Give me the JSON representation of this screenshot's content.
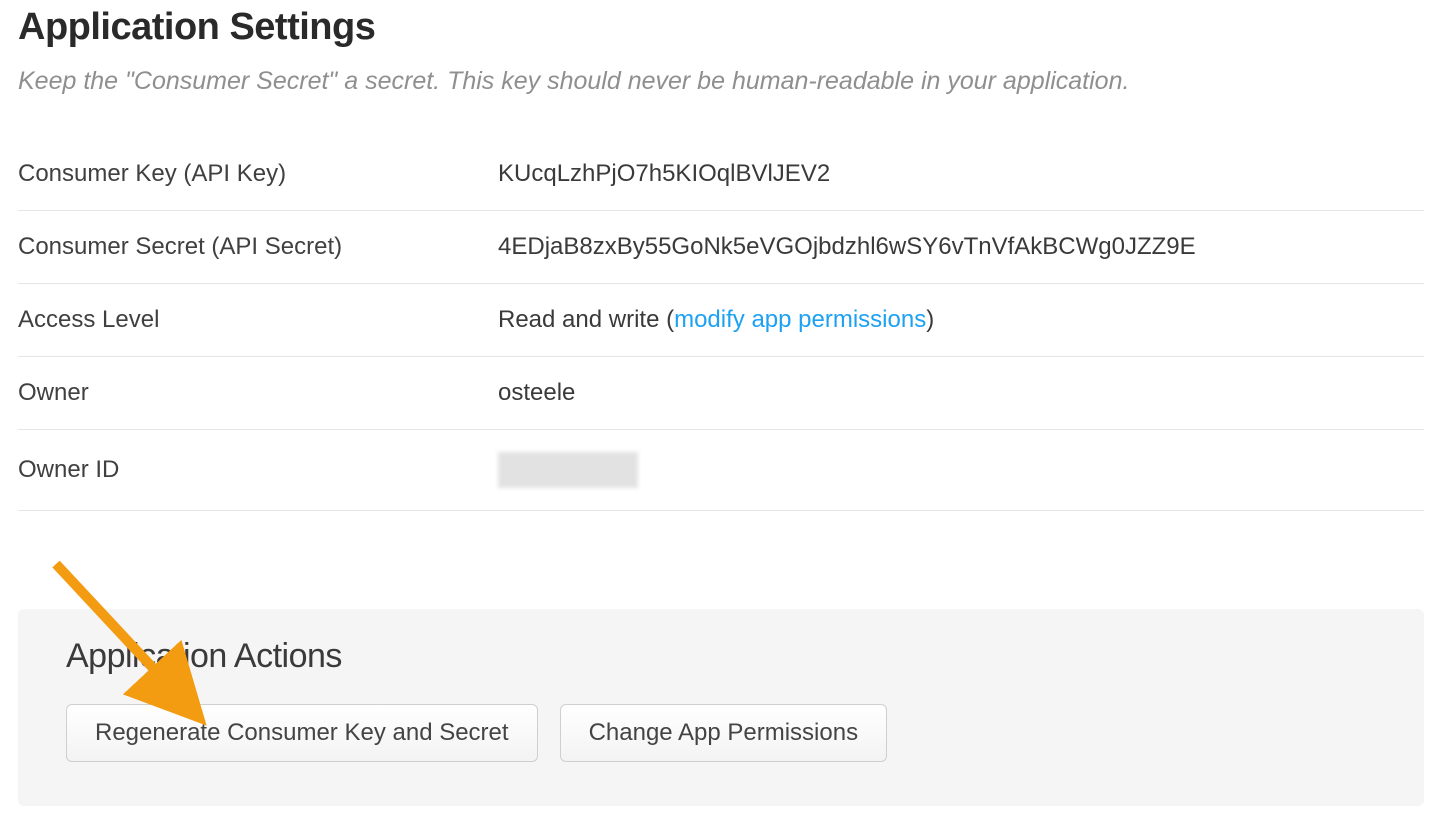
{
  "header": {
    "title": "Application Settings",
    "subtitle": "Keep the \"Consumer Secret\" a secret. This key should never be human-readable in your application."
  },
  "settings": {
    "rows": [
      {
        "label": "Consumer Key (API Key)",
        "value": "KUcqLzhPjO7h5KIOqlBVlJEV2"
      },
      {
        "label": "Consumer Secret (API Secret)",
        "value": "4EDjaB8zxBy55GoNk5eVGOjbdzhl6wSY6vTnVfAkBCWg0JZZ9E"
      },
      {
        "label": "Access Level",
        "value": "Read and write (",
        "link_text": "modify app permissions",
        "suffix": ")"
      },
      {
        "label": "Owner",
        "value": "osteele"
      },
      {
        "label": "Owner ID",
        "value": ""
      }
    ]
  },
  "actions": {
    "title": "Application Actions",
    "buttons": {
      "regenerate": "Regenerate Consumer Key and Secret",
      "change_permissions": "Change App Permissions"
    }
  },
  "colors": {
    "link": "#1da1f2",
    "arrow": "#f39c12"
  }
}
